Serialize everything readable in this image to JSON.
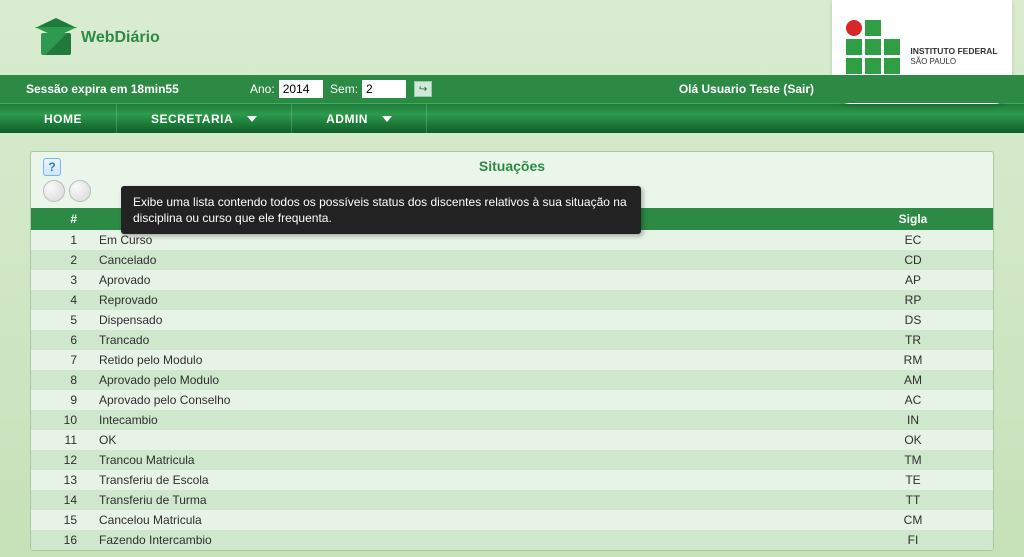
{
  "brand": {
    "name": "WebDiário"
  },
  "session": {
    "expires_label": "Sessão expira em",
    "expires_value": "18min55",
    "ano_label": "Ano:",
    "ano_value": "2014",
    "sem_label": "Sem:",
    "sem_value": "2",
    "hello_prefix": "Olá",
    "user_name": "Usuario Teste",
    "logout_label": "Sair"
  },
  "nav": {
    "home": "HOME",
    "secretaria": "SECRETARIA",
    "admin": "ADMIN"
  },
  "badge": {
    "line1": "INSTITUTO FEDERAL",
    "line2": "SÃO PAULO"
  },
  "page": {
    "title": "Situações",
    "tooltip": "Exibe uma lista contendo todos os possíveis status dos discentes relativos à sua situação na disciplina ou curso que ele frequenta."
  },
  "table": {
    "col_num": "#",
    "col_sigla": "Sigla",
    "rows": [
      {
        "n": "1",
        "nome": "Em Curso",
        "sigla": "EC"
      },
      {
        "n": "2",
        "nome": "Cancelado",
        "sigla": "CD"
      },
      {
        "n": "3",
        "nome": "Aprovado",
        "sigla": "AP"
      },
      {
        "n": "4",
        "nome": "Reprovado",
        "sigla": "RP"
      },
      {
        "n": "5",
        "nome": "Dispensado",
        "sigla": "DS"
      },
      {
        "n": "6",
        "nome": "Trancado",
        "sigla": "TR"
      },
      {
        "n": "7",
        "nome": "Retido pelo Modulo",
        "sigla": "RM"
      },
      {
        "n": "8",
        "nome": "Aprovado pelo Modulo",
        "sigla": "AM"
      },
      {
        "n": "9",
        "nome": "Aprovado pelo Conselho",
        "sigla": "AC"
      },
      {
        "n": "10",
        "nome": "Intecambio",
        "sigla": "IN"
      },
      {
        "n": "11",
        "nome": "OK",
        "sigla": "OK"
      },
      {
        "n": "12",
        "nome": "Trancou Matricula",
        "sigla": "TM"
      },
      {
        "n": "13",
        "nome": "Transferiu de Escola",
        "sigla": "TE"
      },
      {
        "n": "14",
        "nome": "Transferiu de Turma",
        "sigla": "TT"
      },
      {
        "n": "15",
        "nome": "Cancelou Matricula",
        "sigla": "CM"
      },
      {
        "n": "16",
        "nome": "Fazendo Intercambio",
        "sigla": "FI"
      }
    ]
  }
}
